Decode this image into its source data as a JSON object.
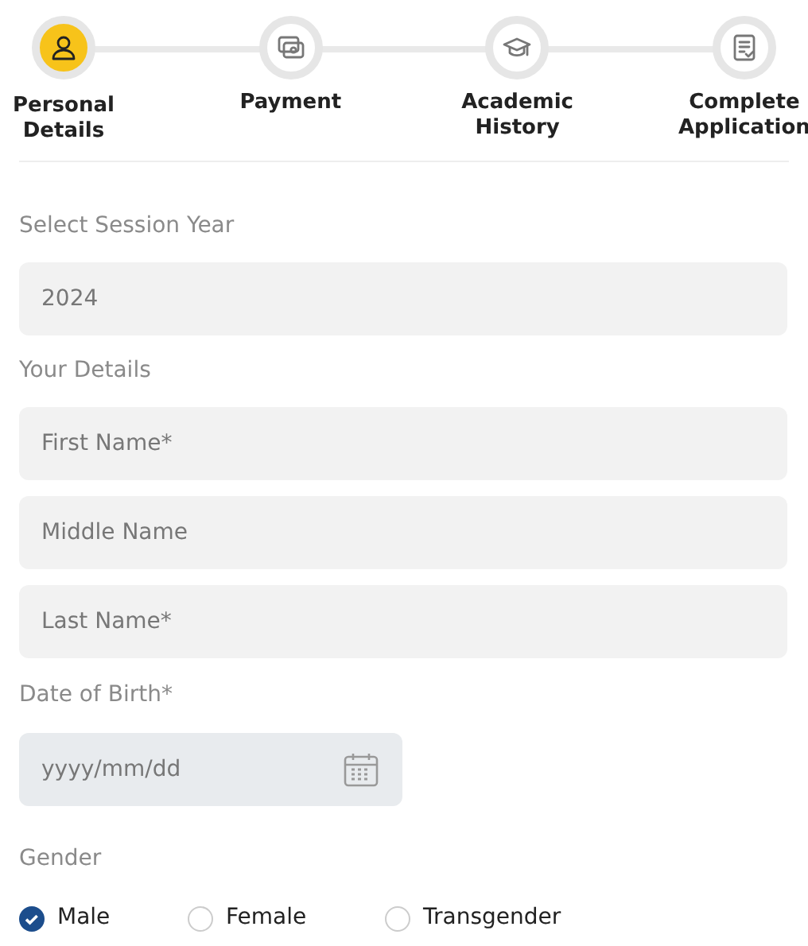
{
  "steps": [
    {
      "label": "Personal Details",
      "selected": true
    },
    {
      "label": "Payment",
      "selected": false
    },
    {
      "label": "Academic History",
      "selected": false
    },
    {
      "label": "Complete Application",
      "selected": false
    }
  ],
  "session": {
    "label": "Select Session Year",
    "value": "2024"
  },
  "details": {
    "label": "Your Details",
    "fields": [
      {
        "placeholder": "First Name*"
      },
      {
        "placeholder": "Middle Name"
      },
      {
        "placeholder": "Last Name*"
      }
    ]
  },
  "dob": {
    "label": "Date of Birth*",
    "placeholder": "yyyy/mm/dd"
  },
  "gender": {
    "label": "Gender",
    "options": [
      {
        "label": "Male",
        "selected": true
      },
      {
        "label": "Female",
        "selected": false
      },
      {
        "label": "Transgender",
        "selected": false
      }
    ]
  }
}
